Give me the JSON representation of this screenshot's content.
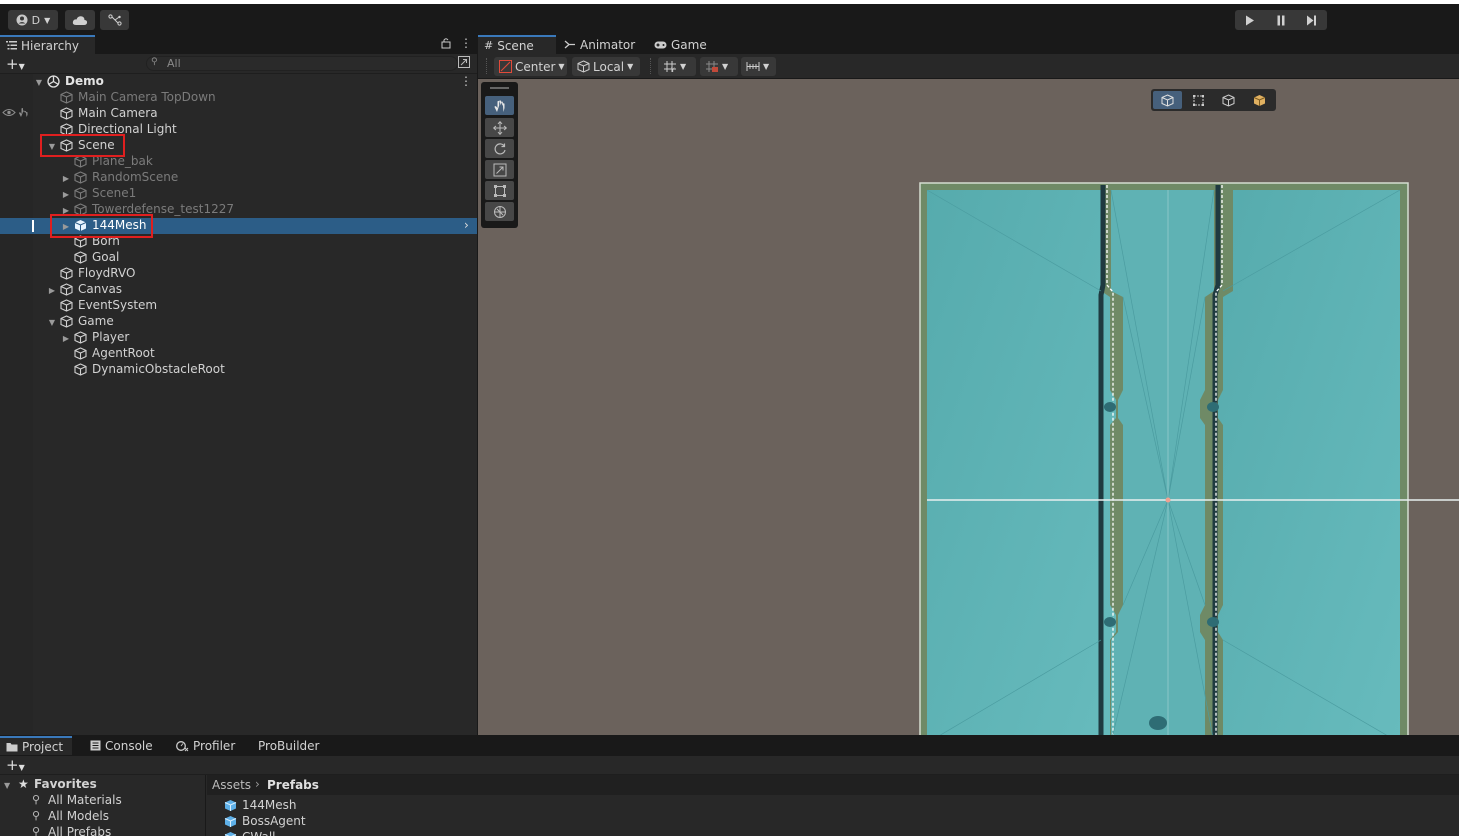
{
  "toolbar": {
    "account_label": "D",
    "cloud_icon": "cloud-icon",
    "collab_icon": "collab-icon"
  },
  "hierarchy": {
    "tab_label": "Hierarchy",
    "search_placeholder": "All",
    "scene_name": "Demo",
    "items": [
      {
        "label": "Main Camera TopDown",
        "depth": 1,
        "dim": true,
        "arrow": false,
        "icon": "gameobject-icon"
      },
      {
        "label": "Main Camera",
        "depth": 1,
        "dim": false,
        "arrow": false,
        "icon": "gameobject-icon"
      },
      {
        "label": "Directional Light",
        "depth": 1,
        "dim": false,
        "arrow": false,
        "icon": "gameobject-icon"
      },
      {
        "label": "Scene",
        "depth": 1,
        "dim": false,
        "arrow": "down",
        "icon": "gameobject-icon"
      },
      {
        "label": "Plane_bak",
        "depth": 2,
        "dim": true,
        "arrow": false,
        "icon": "gameobject-icon"
      },
      {
        "label": "RandomScene",
        "depth": 2,
        "dim": true,
        "arrow": "right",
        "icon": "gameobject-icon"
      },
      {
        "label": "Scene1",
        "depth": 2,
        "dim": true,
        "arrow": "right",
        "icon": "gameobject-icon"
      },
      {
        "label": "Towerdefense_test1227",
        "depth": 2,
        "dim": true,
        "arrow": "right",
        "icon": "gameobject-icon"
      },
      {
        "label": "144Mesh",
        "depth": 2,
        "dim": false,
        "arrow": "right",
        "icon": "prefab-icon",
        "selected": true
      },
      {
        "label": "Born",
        "depth": 2,
        "dim": false,
        "arrow": false,
        "icon": "gameobject-icon"
      },
      {
        "label": "Goal",
        "depth": 2,
        "dim": false,
        "arrow": false,
        "icon": "gameobject-icon"
      },
      {
        "label": "FloydRVO",
        "depth": 1,
        "dim": false,
        "arrow": false,
        "icon": "gameobject-icon"
      },
      {
        "label": "Canvas",
        "depth": 1,
        "dim": false,
        "arrow": "right",
        "icon": "gameobject-icon"
      },
      {
        "label": "EventSystem",
        "depth": 1,
        "dim": false,
        "arrow": false,
        "icon": "gameobject-icon"
      },
      {
        "label": "Game",
        "depth": 1,
        "dim": false,
        "arrow": "down",
        "icon": "gameobject-icon"
      },
      {
        "label": "Player",
        "depth": 2,
        "dim": false,
        "arrow": "right",
        "icon": "gameobject-icon"
      },
      {
        "label": "AgentRoot",
        "depth": 2,
        "dim": false,
        "arrow": false,
        "icon": "gameobject-icon"
      },
      {
        "label": "DynamicObstacleRoot",
        "depth": 2,
        "dim": false,
        "arrow": false,
        "icon": "gameobject-icon"
      }
    ]
  },
  "scene_tabs": {
    "scene": "Scene",
    "animator": "Animator",
    "game": "Game"
  },
  "scene_toolbar": {
    "pivot": "Center",
    "space": "Local"
  },
  "bottom_tabs": {
    "project": "Project",
    "console": "Console",
    "profiler": "Profiler",
    "probuilder": "ProBuilder"
  },
  "project": {
    "favorites_label": "Favorites",
    "favorites": [
      "All Materials",
      "All Models",
      "All Prefabs"
    ],
    "breadcrumb_root": "Assets",
    "breadcrumb_current": "Prefabs",
    "assets": [
      "144Mesh",
      "BossAgent",
      "CWall"
    ]
  },
  "colors": {
    "accent": "#3a79bb",
    "selection": "#2c5d87",
    "highlight_box": "#e01f1f",
    "navmesh": "#5fb2b4",
    "scene_bg": "#6b625c"
  }
}
